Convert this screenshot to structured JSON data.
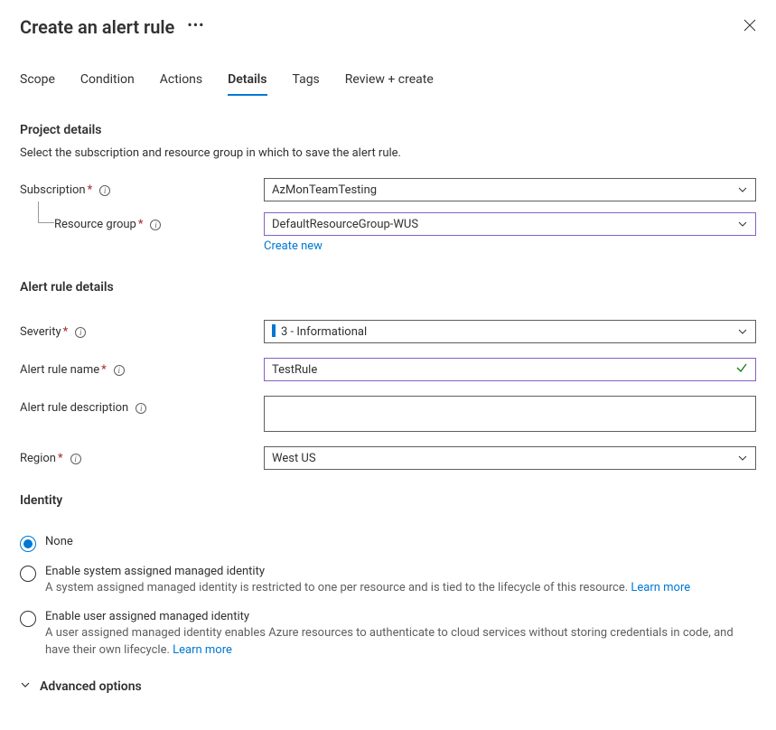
{
  "header": {
    "title": "Create an alert rule"
  },
  "tabs": [
    "Scope",
    "Condition",
    "Actions",
    "Details",
    "Tags",
    "Review + create"
  ],
  "activeTab": "Details",
  "project": {
    "title": "Project details",
    "subtitle": "Select the subscription and resource group in which to save the alert rule.",
    "subscription_label": "Subscription",
    "subscription_value": "AzMonTeamTesting",
    "rg_label": "Resource group",
    "rg_value": "DefaultResourceGroup-WUS",
    "create_new": "Create new"
  },
  "details": {
    "title": "Alert rule details",
    "severity_label": "Severity",
    "severity_value": "3 - Informational",
    "name_label": "Alert rule name",
    "name_value": "TestRule",
    "description_label": "Alert rule description",
    "description_value": "",
    "region_label": "Region",
    "region_value": "West US"
  },
  "identity": {
    "title": "Identity",
    "none_label": "None",
    "system_label": "Enable system assigned managed identity",
    "system_desc": "A system assigned managed identity is restricted to one per resource and is tied to the lifecycle of this resource. ",
    "user_label": "Enable user assigned managed identity",
    "user_desc": "A user assigned managed identity enables Azure resources to authenticate to cloud services without storing credentials in code, and have their own lifecycle. ",
    "learn_more": "Learn more"
  },
  "advanced_options": "Advanced options"
}
